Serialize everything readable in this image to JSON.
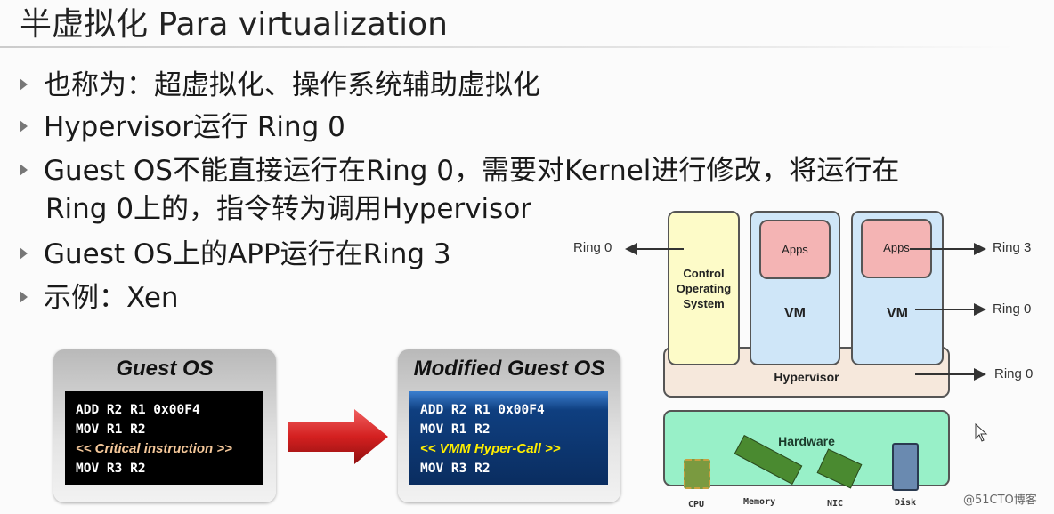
{
  "slide": {
    "title": "半虚拟化  Para virtualization",
    "bullets": [
      "也称为：超虚拟化、操作系统辅助虚拟化",
      "Hypervisor运行 Ring 0",
      "Guest OS不能直接运行在Ring 0，需要对Kernel进行修改，将运行在",
      "Guest OS上的APP运行在Ring 3",
      "示例：Xen"
    ],
    "bullet3_cont": "Ring 0上的，指令转为调用Hypervisor"
  },
  "guest_os": {
    "title": "Guest OS",
    "lines": [
      "ADD R2 R1 0x00F4",
      "MOV R1 R2",
      "<< Critical instruction >>",
      "MOV R3 R2"
    ]
  },
  "modified_os": {
    "title": "Modified Guest OS",
    "lines": [
      "ADD R2 R1 0x00F4",
      "MOV R1 R2",
      "<< VMM Hyper-Call >>",
      "MOV R3 R2"
    ]
  },
  "diagram": {
    "control_os": "Control Operating System",
    "vm": "VM",
    "apps": "Apps",
    "hypervisor": "Hypervisor",
    "hardware": "Hardware",
    "rings": {
      "control": "Ring 0",
      "apps": "Ring 3",
      "vm": "Ring 0",
      "hypervisor": "Ring 0"
    },
    "hw_items": [
      "CPU",
      "Memory",
      "NIC",
      "Disk"
    ]
  },
  "watermark": "@51CTO博客",
  "colors": {
    "critical": "#f5c89a",
    "hypercall": "#ffee00",
    "control": "#fdfbc8",
    "vm": "#cfe6f8",
    "apps": "#f4b4b4",
    "hypervisor": "#f6e8dc",
    "hardware": "#98f0c8",
    "arrow": "#d42020"
  }
}
